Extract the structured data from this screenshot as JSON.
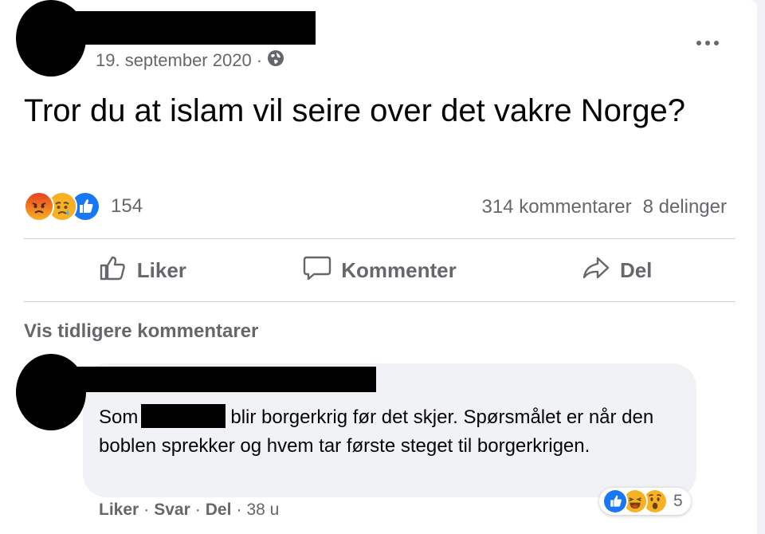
{
  "post": {
    "date": "19. september 2020",
    "separator": "·",
    "audience_icon": "globe-icon",
    "text": "Tror du at islam vil seire over det vakre Norge?",
    "reactions": {
      "icons": [
        "angry-reaction-icon",
        "sad-reaction-icon",
        "like-reaction-icon"
      ],
      "count": "154"
    },
    "comments_count": "314 kommentarer",
    "shares_count": "8 delinger"
  },
  "actions": {
    "like": "Liker",
    "comment": "Kommenter",
    "share": "Del"
  },
  "view_more": "Vis tidligere kommentarer",
  "comment": {
    "text_before": "Som",
    "text_after": "blir borgerkrig før det skjer.",
    "text_rest": "Spørsmålet er når den boblen sprekker og hvem tar første steget til borgerkrigen.",
    "like": "Liker",
    "reply": "Svar",
    "share": "Del",
    "separator": "·",
    "time": "38 u",
    "reaction_count": "5"
  },
  "colors": {
    "like_blue": "#1877f2",
    "reaction_yellow": "#f7b125",
    "angry_red": "#e9710f",
    "secondary_text": "#65676b",
    "bubble_bg": "#f0f2f5"
  }
}
